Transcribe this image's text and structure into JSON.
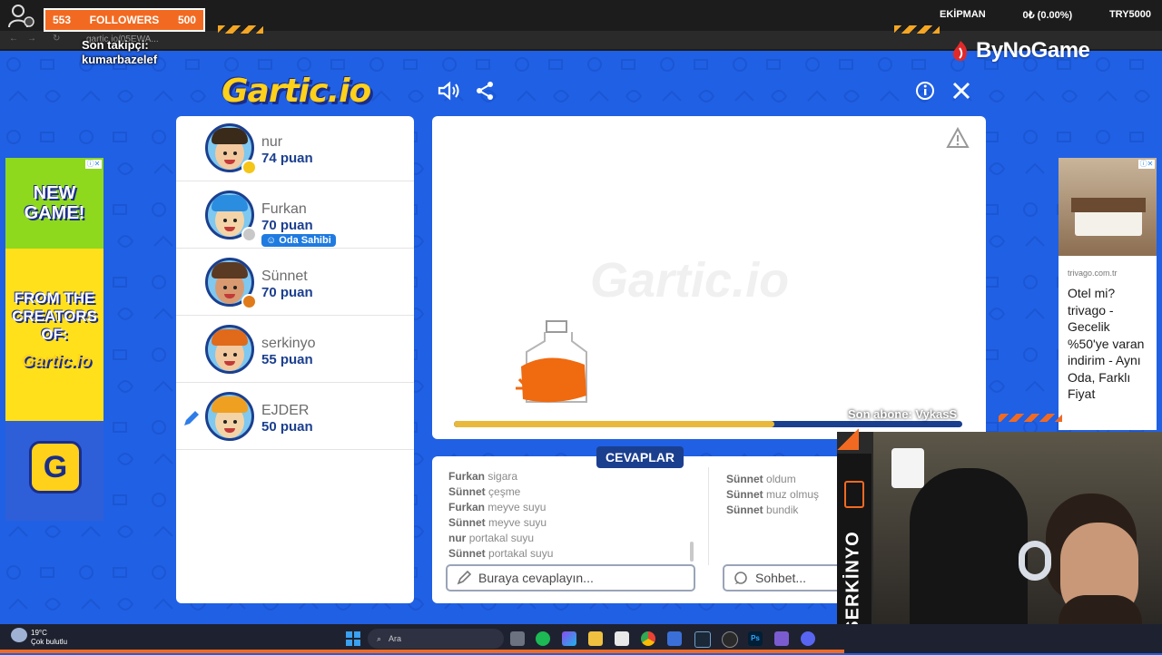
{
  "overlay": {
    "followers_count": "553",
    "followers_label": "FOLLOWERS",
    "followers_goal": "500",
    "last_follower_label": "Son takipçi:",
    "last_follower_name": "kumarbazelef",
    "equipment_label": "EKİPMAN",
    "equipment_value": "0₺ (0.00%)",
    "currency_value": "TRY5000",
    "brand": "ByNoGame",
    "last_subscriber": "Son abone: VykasS",
    "browser_url": "gartic.io/05EWA..."
  },
  "game": {
    "logo_text": "Gartic.io",
    "canvas_watermark": "Gartic.io",
    "progress_fraction": 0.63,
    "players": [
      {
        "name": "nur",
        "score": "74 puan",
        "status_color": "#f5c518",
        "skin": "#f3c9a0",
        "hair": "#3a2a1a"
      },
      {
        "name": "Furkan",
        "score": "70 puan",
        "status_color": "#c8c8c8",
        "badge": "Oda Sahibi",
        "skin": "#f3d4a8",
        "hair": "#2a8de0"
      },
      {
        "name": "Sünnet",
        "score": "70 puan",
        "status_color": "#e07a1a",
        "skin": "#d99a72",
        "hair": "#5a3a22"
      },
      {
        "name": "serkinyo",
        "score": "55 puan",
        "status_color": "",
        "skin": "#f3c9a0",
        "hair": "#e06a1a"
      },
      {
        "name": "EJDER",
        "score": "50 puan",
        "status_color": "",
        "drawing": true,
        "skin": "#f3d4a8",
        "hair": "#f0a020"
      }
    ],
    "answers_tab": "CEVAPLAR",
    "answers": [
      {
        "user": "Furkan",
        "text": "sigara"
      },
      {
        "user": "Sünnet",
        "text": "çeşme"
      },
      {
        "user": "Furkan",
        "text": "meyve suyu"
      },
      {
        "user": "Sünnet",
        "text": "meyve suyu"
      },
      {
        "user": "nur",
        "text": "portakal suyu"
      },
      {
        "user": "Sünnet",
        "text": "portakal suyu"
      }
    ],
    "chat": [
      {
        "user": "Sünnet",
        "text": "oldum"
      },
      {
        "user": "Sünnet",
        "text": "muz olmuş"
      },
      {
        "user": "Sünnet",
        "text": "bundik"
      }
    ],
    "answer_placeholder": "Buraya cevaplayın...",
    "chat_placeholder": "Sohbet..."
  },
  "ads": {
    "left_line1": "NEW GAME!",
    "left_line2": "FROM THE CREATORS OF:",
    "left_logo": "Gartic.io",
    "right_domain": "trivago.com.tr",
    "right_text": "Otel mi? trivago - Gecelik %50'ye varan indirim - Aynı Oda, Farklı Fiyat"
  },
  "webcam": {
    "streamer_label": "SERKİNYO"
  },
  "taskbar": {
    "temperature": "19°C",
    "weather": "Çok bulutlu",
    "search_label": "Ara"
  }
}
